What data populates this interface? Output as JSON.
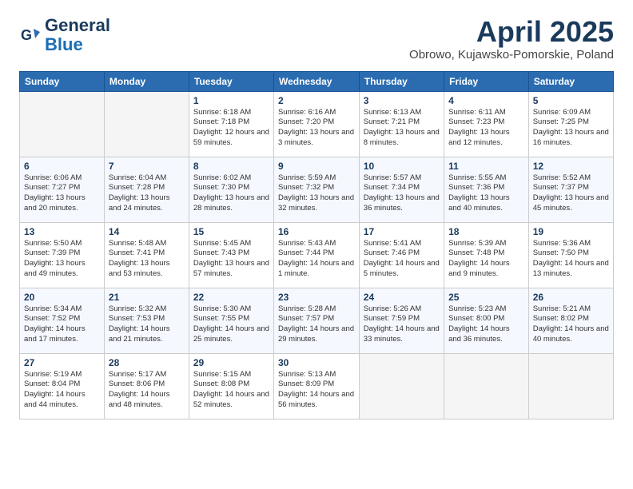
{
  "header": {
    "logo_line1": "General",
    "logo_line2": "Blue",
    "month": "April 2025",
    "location": "Obrowo, Kujawsko-Pomorskie, Poland"
  },
  "weekdays": [
    "Sunday",
    "Monday",
    "Tuesday",
    "Wednesday",
    "Thursday",
    "Friday",
    "Saturday"
  ],
  "weeks": [
    [
      {
        "day": "",
        "info": ""
      },
      {
        "day": "",
        "info": ""
      },
      {
        "day": "1",
        "info": "Sunrise: 6:18 AM\nSunset: 7:18 PM\nDaylight: 12 hours\nand 59 minutes."
      },
      {
        "day": "2",
        "info": "Sunrise: 6:16 AM\nSunset: 7:20 PM\nDaylight: 13 hours\nand 3 minutes."
      },
      {
        "day": "3",
        "info": "Sunrise: 6:13 AM\nSunset: 7:21 PM\nDaylight: 13 hours\nand 8 minutes."
      },
      {
        "day": "4",
        "info": "Sunrise: 6:11 AM\nSunset: 7:23 PM\nDaylight: 13 hours\nand 12 minutes."
      },
      {
        "day": "5",
        "info": "Sunrise: 6:09 AM\nSunset: 7:25 PM\nDaylight: 13 hours\nand 16 minutes."
      }
    ],
    [
      {
        "day": "6",
        "info": "Sunrise: 6:06 AM\nSunset: 7:27 PM\nDaylight: 13 hours\nand 20 minutes."
      },
      {
        "day": "7",
        "info": "Sunrise: 6:04 AM\nSunset: 7:28 PM\nDaylight: 13 hours\nand 24 minutes."
      },
      {
        "day": "8",
        "info": "Sunrise: 6:02 AM\nSunset: 7:30 PM\nDaylight: 13 hours\nand 28 minutes."
      },
      {
        "day": "9",
        "info": "Sunrise: 5:59 AM\nSunset: 7:32 PM\nDaylight: 13 hours\nand 32 minutes."
      },
      {
        "day": "10",
        "info": "Sunrise: 5:57 AM\nSunset: 7:34 PM\nDaylight: 13 hours\nand 36 minutes."
      },
      {
        "day": "11",
        "info": "Sunrise: 5:55 AM\nSunset: 7:36 PM\nDaylight: 13 hours\nand 40 minutes."
      },
      {
        "day": "12",
        "info": "Sunrise: 5:52 AM\nSunset: 7:37 PM\nDaylight: 13 hours\nand 45 minutes."
      }
    ],
    [
      {
        "day": "13",
        "info": "Sunrise: 5:50 AM\nSunset: 7:39 PM\nDaylight: 13 hours\nand 49 minutes."
      },
      {
        "day": "14",
        "info": "Sunrise: 5:48 AM\nSunset: 7:41 PM\nDaylight: 13 hours\nand 53 minutes."
      },
      {
        "day": "15",
        "info": "Sunrise: 5:45 AM\nSunset: 7:43 PM\nDaylight: 13 hours\nand 57 minutes."
      },
      {
        "day": "16",
        "info": "Sunrise: 5:43 AM\nSunset: 7:44 PM\nDaylight: 14 hours\nand 1 minute."
      },
      {
        "day": "17",
        "info": "Sunrise: 5:41 AM\nSunset: 7:46 PM\nDaylight: 14 hours\nand 5 minutes."
      },
      {
        "day": "18",
        "info": "Sunrise: 5:39 AM\nSunset: 7:48 PM\nDaylight: 14 hours\nand 9 minutes."
      },
      {
        "day": "19",
        "info": "Sunrise: 5:36 AM\nSunset: 7:50 PM\nDaylight: 14 hours\nand 13 minutes."
      }
    ],
    [
      {
        "day": "20",
        "info": "Sunrise: 5:34 AM\nSunset: 7:52 PM\nDaylight: 14 hours\nand 17 minutes."
      },
      {
        "day": "21",
        "info": "Sunrise: 5:32 AM\nSunset: 7:53 PM\nDaylight: 14 hours\nand 21 minutes."
      },
      {
        "day": "22",
        "info": "Sunrise: 5:30 AM\nSunset: 7:55 PM\nDaylight: 14 hours\nand 25 minutes."
      },
      {
        "day": "23",
        "info": "Sunrise: 5:28 AM\nSunset: 7:57 PM\nDaylight: 14 hours\nand 29 minutes."
      },
      {
        "day": "24",
        "info": "Sunrise: 5:26 AM\nSunset: 7:59 PM\nDaylight: 14 hours\nand 33 minutes."
      },
      {
        "day": "25",
        "info": "Sunrise: 5:23 AM\nSunset: 8:00 PM\nDaylight: 14 hours\nand 36 minutes."
      },
      {
        "day": "26",
        "info": "Sunrise: 5:21 AM\nSunset: 8:02 PM\nDaylight: 14 hours\nand 40 minutes."
      }
    ],
    [
      {
        "day": "27",
        "info": "Sunrise: 5:19 AM\nSunset: 8:04 PM\nDaylight: 14 hours\nand 44 minutes."
      },
      {
        "day": "28",
        "info": "Sunrise: 5:17 AM\nSunset: 8:06 PM\nDaylight: 14 hours\nand 48 minutes."
      },
      {
        "day": "29",
        "info": "Sunrise: 5:15 AM\nSunset: 8:08 PM\nDaylight: 14 hours\nand 52 minutes."
      },
      {
        "day": "30",
        "info": "Sunrise: 5:13 AM\nSunset: 8:09 PM\nDaylight: 14 hours\nand 56 minutes."
      },
      {
        "day": "",
        "info": ""
      },
      {
        "day": "",
        "info": ""
      },
      {
        "day": "",
        "info": ""
      }
    ]
  ]
}
